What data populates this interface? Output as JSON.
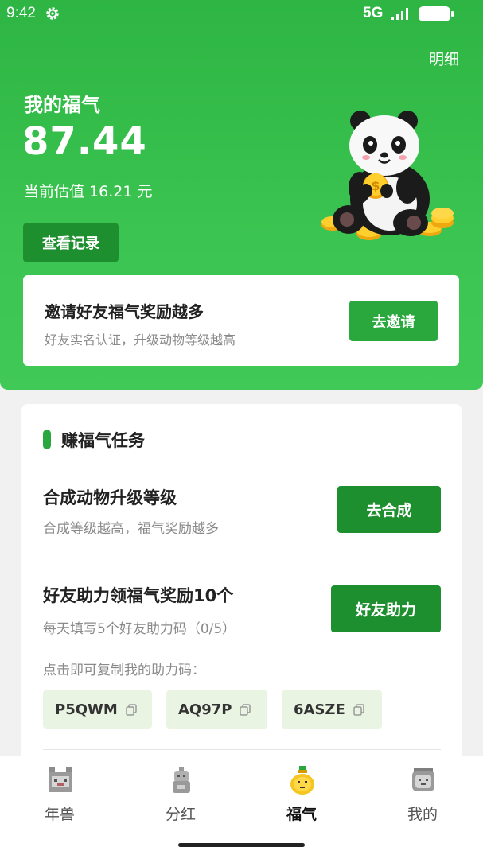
{
  "status_bar": {
    "time": "9:42",
    "network": "5G",
    "icons": [
      "gear-icon",
      "signal-icon",
      "battery-icon"
    ]
  },
  "header": {
    "detail_link": "明细",
    "fortune_label": "我的福气",
    "fortune_value": "87.44",
    "estimate_text": "当前估值 16.21 元",
    "records_button": "查看记录"
  },
  "invite": {
    "title": "邀请好友福气奖励越多",
    "subtitle": "好友实名认证，升级动物等级越高",
    "button": "去邀请"
  },
  "tasks": {
    "section_title": "赚福气任务",
    "items": [
      {
        "title": "合成动物升级等级",
        "subtitle": "合成等级越高，福气奖励越多",
        "button": "去合成"
      },
      {
        "title": "好友助力领福气奖励10个",
        "subtitle": "每天填写5个好友助力码（0/5）",
        "button": "好友助力"
      }
    ],
    "copy_hint": "点击即可复制我的助力码：",
    "codes": [
      "P5QWM",
      "AQ97P",
      "6ASZE"
    ]
  },
  "tabbar": {
    "tabs": [
      {
        "label": "年兽",
        "icon": "nianshou-icon",
        "active": false
      },
      {
        "label": "分红",
        "icon": "robot-icon",
        "active": false
      },
      {
        "label": "福气",
        "icon": "fortune-bag-icon",
        "active": true
      },
      {
        "label": "我的",
        "icon": "profile-icon",
        "active": false
      }
    ]
  },
  "colors": {
    "brand_green": "#2eb543",
    "button_dark_green": "#1e8f2f",
    "chip_bg": "#e9f4e3"
  }
}
